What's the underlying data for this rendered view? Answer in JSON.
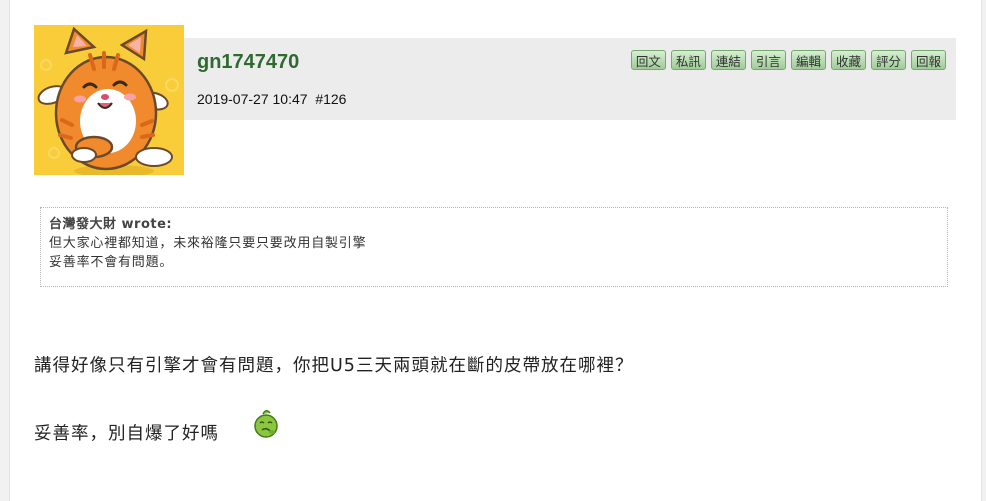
{
  "post": {
    "username": "gn1747470",
    "timestamp": "2019-07-27 10:47",
    "post_number": "#126",
    "meta_line": "2019-07-27 10:47  #126",
    "actions": [
      "回文",
      "私訊",
      "連結",
      "引言",
      "編輯",
      "收藏",
      "評分",
      "回報"
    ],
    "avatar_icon": "orange-cat-sticker"
  },
  "quote": {
    "author_line": "台灣發大財 wrote:",
    "lines": [
      "但大家心裡都知道，未來裕隆只要只要改用自製引擎",
      "妥善率不會有問題。"
    ]
  },
  "content": {
    "paragraphs": [
      "講得好像只有引擎才會有問題，你把U5三天兩頭就在斷的皮帶放在哪裡？",
      "妥善率，別自爆了好嗎"
    ],
    "emoticon": "green-blob-emoticon"
  },
  "colors": {
    "username": "#2f6b2f",
    "header_bg": "#ececec",
    "button_green": "#9fcb98",
    "avatar_bg": "#f9cd3a"
  }
}
